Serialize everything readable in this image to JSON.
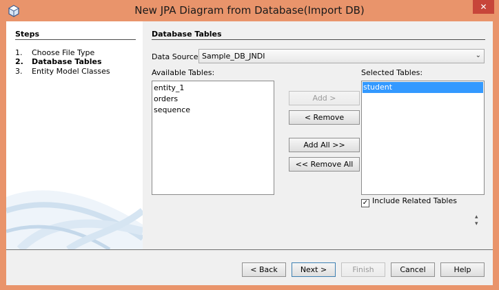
{
  "window": {
    "title": "New JPA Diagram from Database(Import DB)",
    "close_glyph": "✕",
    "app_icon": "jpa-cube-icon"
  },
  "steps": {
    "heading": "Steps",
    "items": [
      {
        "num": "1.",
        "label": "Choose File Type",
        "active": false
      },
      {
        "num": "2.",
        "label": "Database Tables",
        "active": true
      },
      {
        "num": "3.",
        "label": "Entity Model Classes",
        "active": false
      }
    ]
  },
  "main": {
    "heading": "Database Tables",
    "data_source_label": "Data Source:",
    "data_source_value": "Sample_DB_JNDI",
    "available_label": "Available Tables:",
    "available_tables": [
      "entity_1",
      "orders",
      "sequence"
    ],
    "selected_label": "Selected Tables:",
    "selected_tables": [
      "student"
    ],
    "buttons": {
      "add": "Add >",
      "remove": "< Remove",
      "add_all": "Add All >>",
      "remove_all": "<< Remove All"
    },
    "include_related_label": "Include Related Tables",
    "include_related_checked": true
  },
  "footer": {
    "back": "< Back",
    "next": "Next >",
    "finish": "Finish",
    "cancel": "Cancel",
    "help": "Help"
  },
  "colors": {
    "frame": "#e9946b",
    "selection": "#3399ff",
    "close": "#c7453a"
  }
}
